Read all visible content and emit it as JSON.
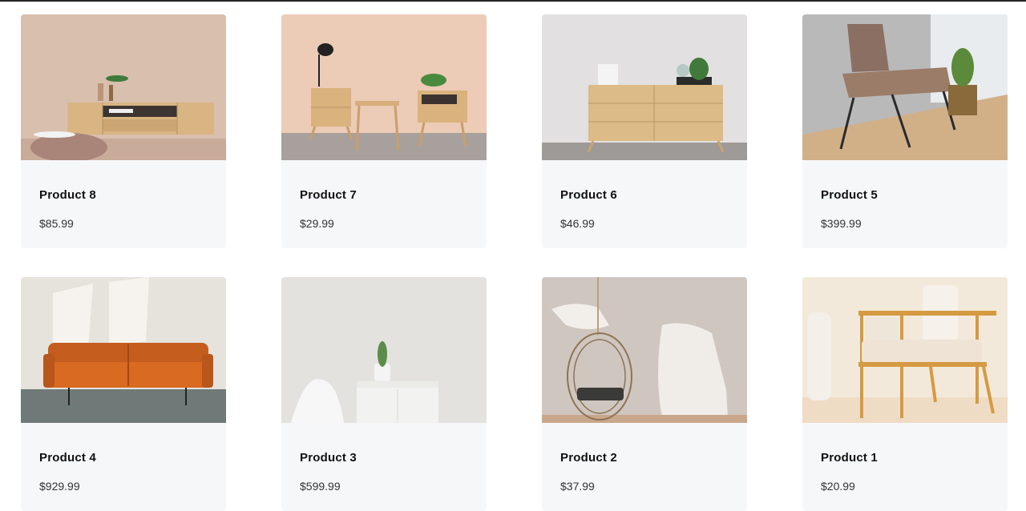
{
  "products": [
    {
      "name": "Product 8",
      "price": "$85.99",
      "image": "tv-console-photo"
    },
    {
      "name": "Product 7",
      "price": "$29.99",
      "image": "nightstands-photo"
    },
    {
      "name": "Product 6",
      "price": "$46.99",
      "image": "dresser-photo"
    },
    {
      "name": "Product 5",
      "price": "$399.99",
      "image": "lounge-chair-photo"
    },
    {
      "name": "Product 4",
      "price": "$929.99",
      "image": "leather-sofa-photo"
    },
    {
      "name": "Product 3",
      "price": "$599.99",
      "image": "white-cabinet-photo"
    },
    {
      "name": "Product 2",
      "price": "$37.99",
      "image": "hanging-chair-photo"
    },
    {
      "name": "Product 1",
      "price": "$20.99",
      "image": "wooden-armchair-photo"
    }
  ],
  "colors": {
    "card_background": "#f6f7f9",
    "title": "#111111",
    "price": "#333333"
  }
}
